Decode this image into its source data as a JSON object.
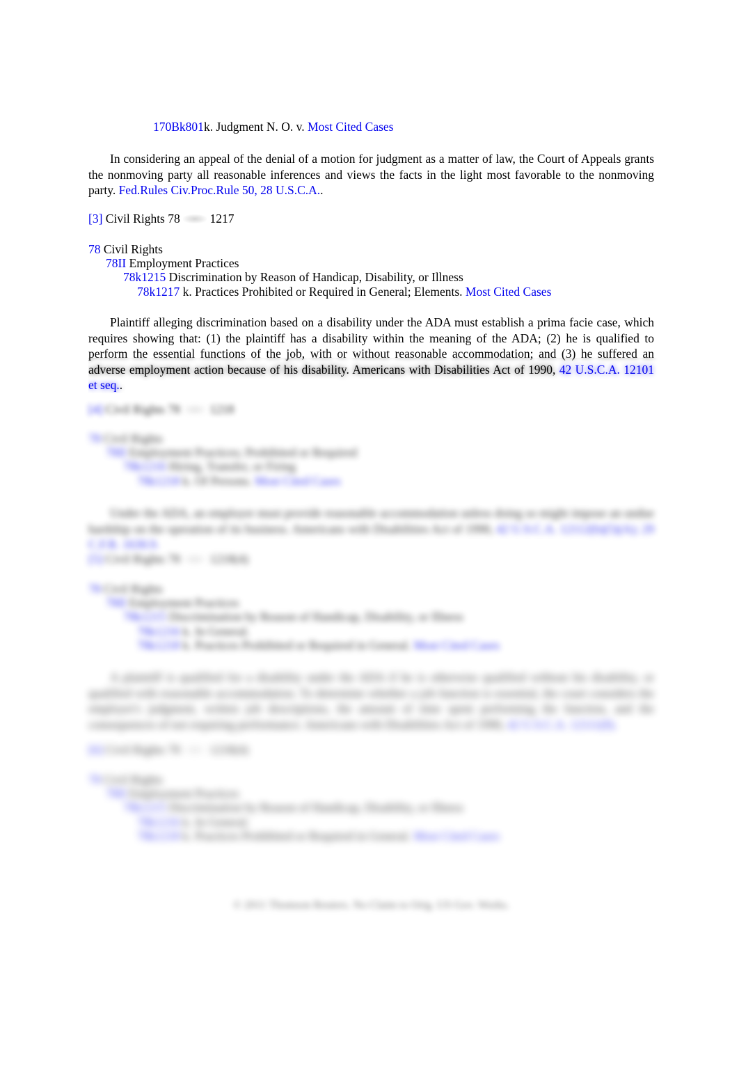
{
  "document": {
    "type": "westlaw-case-headnotes",
    "link_color": "#0000EE",
    "text_color": "#000000",
    "background": "#ffffff"
  },
  "top_headnote": {
    "key_number": "170Bk801",
    "topic_text": "k. Judgment N. O. v.",
    "most_cited": "Most Cited Cases"
  },
  "holding_1": {
    "text": "In considering an appeal of the denial of a motion for judgment as a matter of law, the Court of Appeals grants the nonmoving party all reasonable inferences and views the facts in the light most favorable to the nonmoving party. ",
    "citation": "Fed.Rules Civ.Proc.Rule 50, 28 U.S.C.A.",
    "period": "."
  },
  "headnote_3": {
    "marker": "[3]",
    "topic": "Civil Rights 78",
    "key_icon": "west-key-icon",
    "number": "1217"
  },
  "tree_3": {
    "level0": {
      "num": "78",
      "label": "Civil Rights"
    },
    "level1": {
      "num": "78II",
      "label": "Employment Practices"
    },
    "level2": {
      "num": "78k1215",
      "label": "Discrimination by Reason of Handicap, Disability, or Illness"
    },
    "level3": {
      "num": "78k1217",
      "label": "k. Practices Prohibited or Required in General; Elements.",
      "most_cited": "Most Cited Cases"
    }
  },
  "holding_3": {
    "text": "Plaintiff alleging discrimination based on a disability under the ADA must establish a prima facie case, which requires showing that: (1) the plaintiff has a disability within the meaning of the ADA; (2) he is qualified to perform the essential functions of the job, with or without reasonable accommodation; and (3) he suffered an adverse employment action because of his disability. Americans with Disabilities Act of 1990, ",
    "citation": "42 U.S.C.A. 12101 et seq.",
    "tail": "."
  },
  "headnote_4": {
    "marker": "[4]",
    "topic": "Civil Rights 78",
    "key_icon": "west-key-icon",
    "number": "1218"
  },
  "tree_4": {
    "level0": {
      "num": "78",
      "label": "Civil Rights"
    },
    "level1": {
      "num": "78II",
      "label": "Employment Practices; Prohibited or Required"
    },
    "level2": {
      "num": "78k1216",
      "label": "Hiring, Transfer, or Firing"
    },
    "level3": {
      "num": "78k1218",
      "label": "k. Of Persons.",
      "most_cited": "Most Cited Cases"
    }
  },
  "holding_4": {
    "text": "Under the ADA, an employer must provide reasonable accommodation unless doing so might impose an undue hardship on the operation of its business. Americans with Disabilities Act of 1990, ",
    "citation": "42 U.S.C.A. 12112(b)(5)(A); 29 C.F.R. 1630.9.",
    "tail": ""
  },
  "headnote_5": {
    "marker": "[5]",
    "topic": "Civil Rights 78",
    "key_icon": "west-key-icon",
    "number": "1218(4)"
  },
  "tree_5": {
    "level0": {
      "num": "78",
      "label": "Civil Rights"
    },
    "level1": {
      "num": "78II",
      "label": "Employment Practices"
    },
    "level2": {
      "num": "78k1215",
      "label": "Discrimination by Reason of Handicap, Disability, or Illness"
    },
    "level3": {
      "num": "78k1216",
      "label": "k. In General."
    },
    "level4": {
      "num": "78k1218",
      "label": "k. Practices Prohibited or Required in General.",
      "most_cited": "Most Cited Cases"
    }
  },
  "holding_5": {
    "text": "A plaintiff is qualified for a disability under the ADA if he is otherwise qualified without his disability, or qualified with reasonable accommodation. To determine whether a job function is essential, the court considers the employer's judgment, written job descriptions, the amount of time spent performing the function, and the consequences of not requiring performance. Americans with Disabilities Act of 1990, ",
    "citation": "42 U.S.C.A. 12111(8).",
    "tail": ""
  },
  "headnote_6": {
    "marker": "[6]",
    "topic": "Civil Rights 78",
    "key_icon": "west-key-icon",
    "number": "1218(4)"
  },
  "tree_6": {
    "level0": {
      "num": "78",
      "label": "Civil Rights"
    },
    "level1": {
      "num": "78II",
      "label": "Employment Practices"
    },
    "level2": {
      "num": "78k1215",
      "label": "Discrimination by Reason of Handicap, Disability, or Illness"
    },
    "level3": {
      "num": "78k1216",
      "label": "k. In General."
    },
    "level4": {
      "num": "78k1218",
      "label": "k. Practices Prohibited or Required in General.",
      "most_cited": "Most Cited Cases"
    }
  },
  "footer": {
    "copyright": "© 2011 Thomson Reuters. No Claim to Orig. US Gov. Works."
  }
}
